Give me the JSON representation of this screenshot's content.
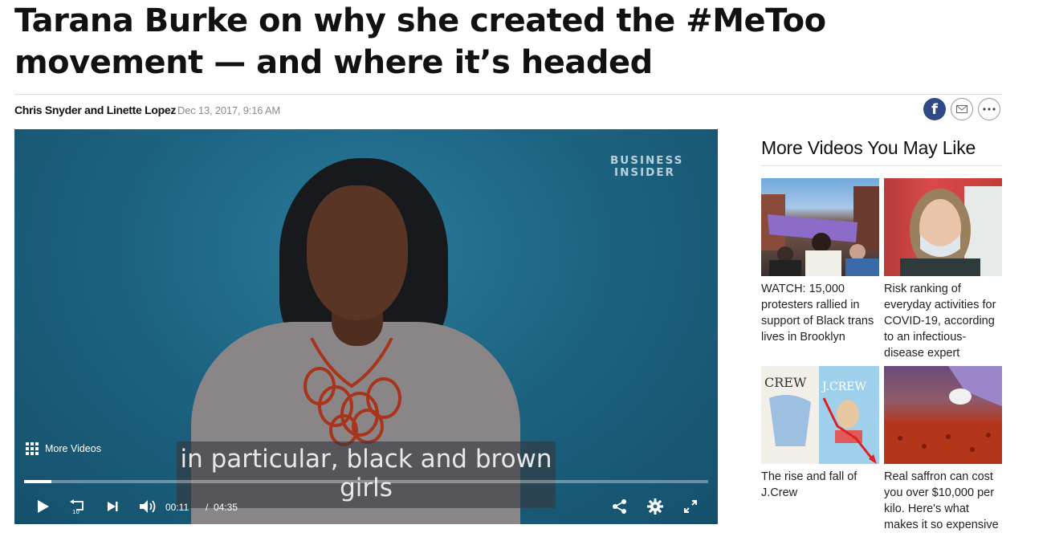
{
  "article": {
    "headline": "Tarana Burke on why she created the #MeToo movement — and where it’s headed",
    "authors": "Chris Snyder and Linette Lopez",
    "date": "Dec 13, 2017, 9:16 AM"
  },
  "share": {
    "facebook_icon": "facebook-icon",
    "email_icon": "email-icon",
    "more_icon": "more-options-icon"
  },
  "video": {
    "logo": "BUSINESS INSIDER",
    "more_videos_label": "More Videos",
    "caption": "in particular, black and brown girls",
    "current_time": "00:11",
    "separator": "/",
    "duration": "04:35",
    "progress": 0.04,
    "icons": [
      "play-icon",
      "replay-10-icon",
      "next-icon",
      "volume-icon",
      "share-icon",
      "settings-icon",
      "fullscreen-icon"
    ]
  },
  "sidebar": {
    "title": "More Videos You May Like",
    "videos": [
      {
        "title": "WATCH: 15,000 protesters rallied in support of Black trans lives in Brooklyn"
      },
      {
        "title": "Risk ranking of everyday activities for COVID-19, according to an infectious-disease expert"
      },
      {
        "title": "The rise and fall of J.Crew",
        "thumb_text_1": "CREW",
        "thumb_text_2": "J.CREW"
      },
      {
        "title": "Real saffron can cost you over $10,000 per kilo. Here's what makes it so expensive"
      }
    ]
  },
  "colors": {
    "player_bg": "#1d6482",
    "facebook": "#2e4a86",
    "caption_bg": "#37373c"
  }
}
